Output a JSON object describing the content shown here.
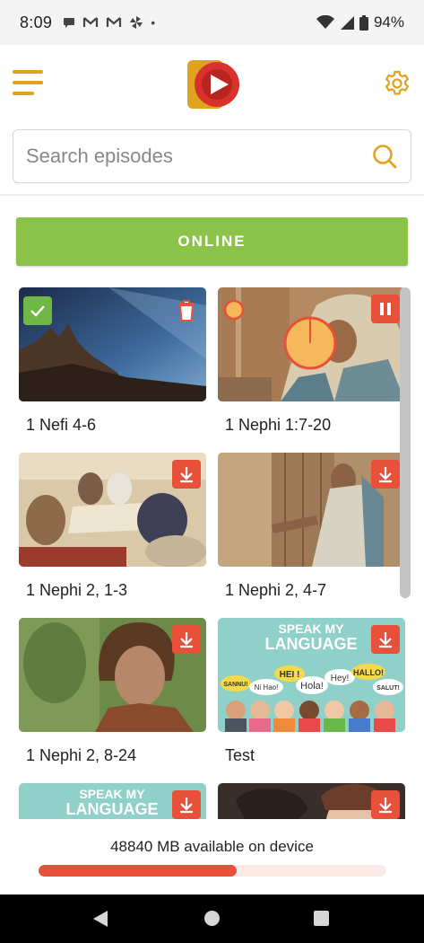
{
  "status_bar": {
    "time": "8:09",
    "battery": "94%",
    "icons": [
      "message-icon",
      "gmail-icon",
      "gmail-icon",
      "pinwheel-icon",
      "dot-icon"
    ],
    "right_icons": [
      "wifi-icon",
      "signal-icon",
      "battery-icon"
    ]
  },
  "header": {
    "menu_icon": "hamburger-menu-icon",
    "logo_icon": "play-logo-icon",
    "settings_icon": "gear-icon"
  },
  "search": {
    "placeholder": "Search episodes",
    "value": ""
  },
  "online_button": {
    "label": "ONLINE"
  },
  "colors": {
    "accent_gold": "#e0a31e",
    "online_green": "#8bc34a",
    "download_red": "#e8503a",
    "check_green": "#6fb845"
  },
  "episodes": [
    {
      "title": "1 Nefi 4-6",
      "state": "downloaded",
      "badges": [
        "check-icon",
        "trash-icon"
      ]
    },
    {
      "title": "1 Nephi 1:7-20",
      "state": "downloading",
      "progress": 0.03,
      "badges": [
        "pause-icon"
      ]
    },
    {
      "title": "1 Nephi 2, 1-3",
      "state": "not_downloaded",
      "badges": [
        "download-icon"
      ]
    },
    {
      "title": "1 Nephi 2, 4-7",
      "state": "not_downloaded",
      "badges": [
        "download-icon"
      ]
    },
    {
      "title": "1 Nephi 2, 8-24",
      "state": "not_downloaded",
      "badges": [
        "download-icon"
      ]
    },
    {
      "title": "Test",
      "state": "not_downloaded",
      "badges": [
        "download-icon"
      ]
    },
    {
      "title": "",
      "state": "not_downloaded",
      "badges": [
        "download-icon"
      ]
    },
    {
      "title": "",
      "state": "not_downloaded",
      "badges": [
        "download-icon"
      ]
    }
  ],
  "thumb_text": {
    "speak_my": "SPEAK MY",
    "language": "LANGUAGE",
    "bubbles": [
      "HEI !",
      "Hey!",
      "HALLO!",
      "SANNU!",
      "Ni Hao!",
      "Hola!",
      "SALUT!"
    ]
  },
  "storage": {
    "text": "48840 MB available on device",
    "used_fraction": 0.57
  },
  "nav": {
    "icons": [
      "back-icon",
      "home-icon",
      "recents-icon"
    ]
  }
}
